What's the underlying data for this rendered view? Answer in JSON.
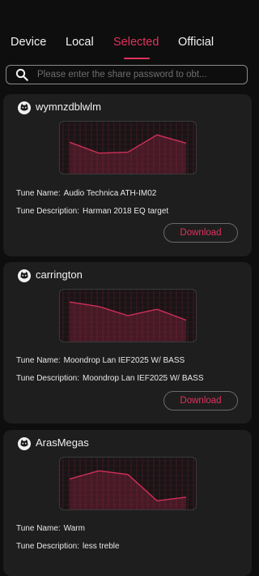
{
  "tabs": [
    {
      "label": "Device"
    },
    {
      "label": "Local"
    },
    {
      "label": "Selected",
      "active": true
    },
    {
      "label": "Official"
    }
  ],
  "search": {
    "placeholder": "Please enter the share password to obt...",
    "icon": "search-icon"
  },
  "colors": {
    "accent": "#e0325e",
    "background": "#0e0e0e",
    "card": "#1e1e1f"
  },
  "labels": {
    "tune_name": "Tune Name:",
    "tune_description": "Tune Description:",
    "download": "Download"
  },
  "cards": [
    {
      "user": "wymnzdblwlm",
      "tune_name": "Audio Technica ATH-IM02",
      "tune_description": "Harman 2018 EQ target",
      "curve_levels": [
        0.62,
        0.38,
        0.4,
        0.78,
        0.6
      ]
    },
    {
      "user": "carrington",
      "tune_name": "Moondrop Lan IEF2025 W/ BASS",
      "tune_description": "Moondrop Lan IEF2025 W/ BASS",
      "curve_levels": [
        0.8,
        0.7,
        0.5,
        0.64,
        0.4
      ]
    },
    {
      "user": "ArasMegas",
      "tune_name": "Warm",
      "tune_description": "less treble",
      "curve_levels": [
        0.6,
        0.78,
        0.7,
        0.12,
        0.2
      ]
    }
  ]
}
